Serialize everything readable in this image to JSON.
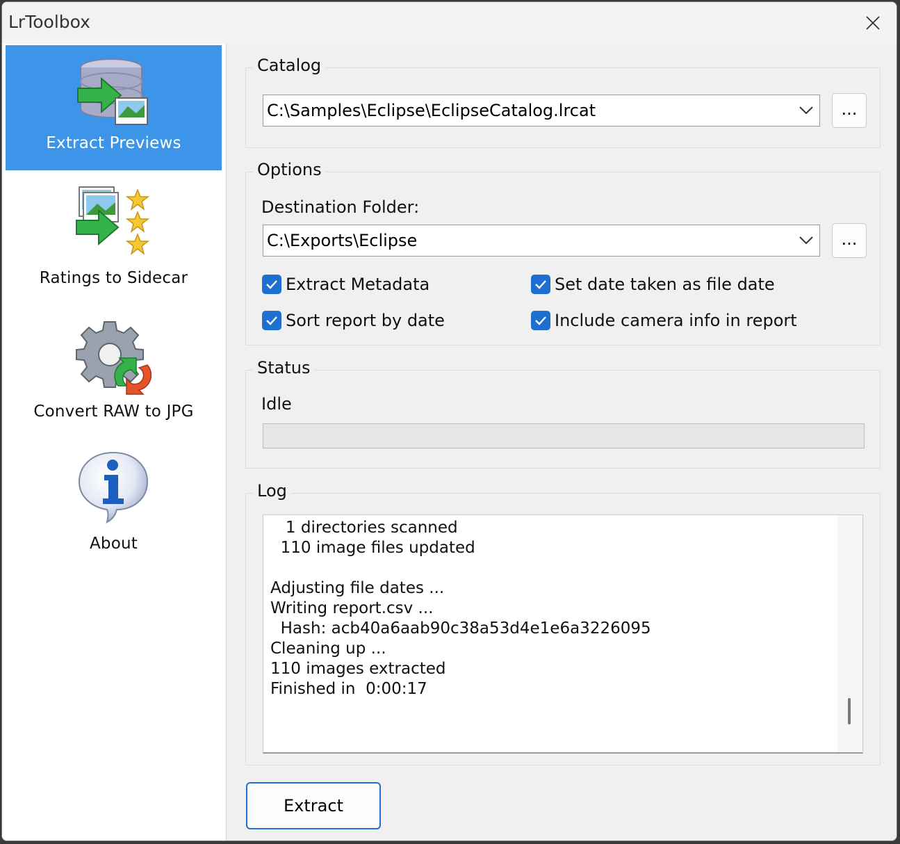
{
  "window": {
    "title": "LrToolbox"
  },
  "sidebar": {
    "items": [
      {
        "label": "Extract Previews",
        "icon": "database-extract-icon",
        "active": true
      },
      {
        "label": "Ratings to Sidecar",
        "icon": "ratings-stars-icon",
        "active": false
      },
      {
        "label": "Convert RAW to JPG",
        "icon": "gear-convert-icon",
        "active": false
      },
      {
        "label": "About",
        "icon": "info-bubble-icon",
        "active": false
      }
    ]
  },
  "catalog": {
    "legend": "Catalog",
    "path": "C:\\Samples\\Eclipse\\EclipseCatalog.lrcat",
    "browse_label": "..."
  },
  "options": {
    "legend": "Options",
    "destination_label": "Destination Folder:",
    "destination_path": "C:\\Exports\\Eclipse",
    "browse_label": "...",
    "checkboxes": [
      {
        "label": "Extract Metadata",
        "checked": true
      },
      {
        "label": "Set date taken as file date",
        "checked": true
      },
      {
        "label": "Sort report by date",
        "checked": true
      },
      {
        "label": "Include camera info in report",
        "checked": true
      }
    ]
  },
  "status": {
    "legend": "Status",
    "text": "Idle",
    "progress": 0
  },
  "log": {
    "legend": "Log",
    "lines": [
      "   1 directories scanned",
      "  110 image files updated",
      "",
      "Adjusting file dates ...",
      "Writing report.csv ...",
      "  Hash: acb40a6aab90c38a53d4e1e6a3226095",
      "Cleaning up ...",
      "110 images extracted",
      "Finished in  0:00:17"
    ]
  },
  "actions": {
    "extract_label": "Extract"
  },
  "colors": {
    "accent": "#3c95e8",
    "checkbox": "#1f6fd1"
  }
}
